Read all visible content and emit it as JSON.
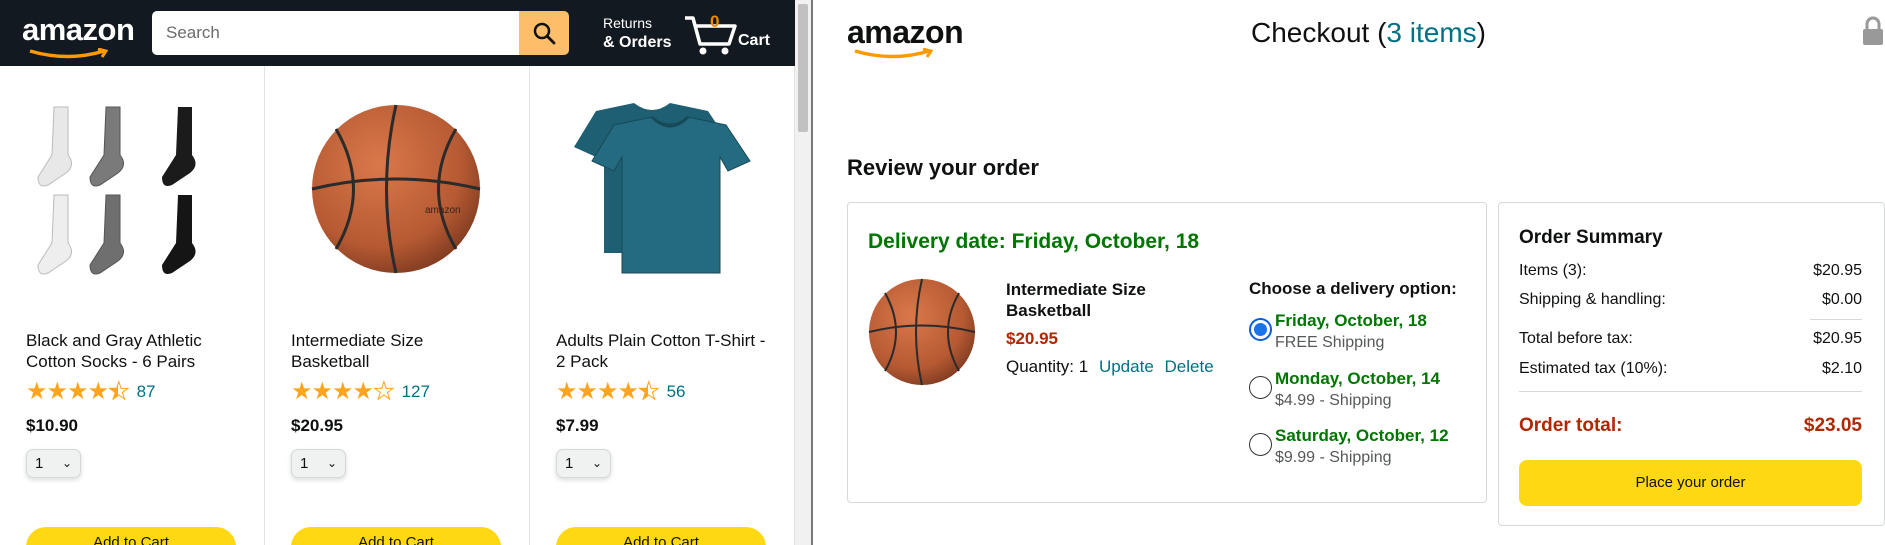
{
  "store": {
    "logo": "amazon",
    "search": {
      "placeholder": "Search"
    },
    "returns": {
      "line1": "Returns",
      "line2": "& Orders"
    },
    "cart": {
      "count": "0",
      "label": "Cart"
    },
    "products": [
      {
        "name": "Black and Gray Athletic Cotton Socks - 6 Pairs",
        "stars": 4.5,
        "rating_count": "87",
        "price": "$10.90",
        "qty": "1",
        "add_label": "Add to Cart",
        "image": "socks"
      },
      {
        "name": "Intermediate Size Basketball",
        "stars": 4.0,
        "rating_count": "127",
        "price": "$20.95",
        "qty": "1",
        "add_label": "Add to Cart",
        "image": "basketball"
      },
      {
        "name": "Adults Plain Cotton T-Shirt - 2 Pack",
        "stars": 4.5,
        "rating_count": "56",
        "price": "$7.99",
        "qty": "1",
        "add_label": "Add to Cart",
        "image": "tshirts"
      }
    ]
  },
  "checkout": {
    "logo": "amazon",
    "title_prefix": "Checkout (",
    "title_items": "3 items",
    "title_suffix": ")",
    "review_title": "Review your order",
    "order": {
      "delivery_date": "Delivery date: Friday, October, 18",
      "item_name": "Intermediate Size Basketball",
      "item_price": "$20.95",
      "quantity_label": "Quantity: 1",
      "update_label": "Update",
      "delete_label": "Delete",
      "choose_label": "Choose a delivery option:",
      "options": [
        {
          "date": "Friday, October, 18",
          "shipping": "FREE Shipping",
          "selected": true
        },
        {
          "date": "Monday, October, 14",
          "shipping": "$4.99 - Shipping",
          "selected": false
        },
        {
          "date": "Saturday, October, 12",
          "shipping": "$9.99 - Shipping",
          "selected": false
        }
      ]
    },
    "summary": {
      "title": "Order Summary",
      "items_label": "Items (3):",
      "items_value": "$20.95",
      "shipping_label": "Shipping & handling:",
      "shipping_value": "$0.00",
      "before_tax_label": "Total before tax:",
      "before_tax_value": "$20.95",
      "tax_label": "Estimated tax (10%):",
      "tax_value": "$2.10",
      "total_label": "Order total:",
      "total_value": "$23.05",
      "place_order_label": "Place your order"
    }
  },
  "colors": {
    "nav_bg": "#131921",
    "search_button": "#febd69",
    "accent_yellow": "#ffd814",
    "star": "#ffa41c",
    "link": "#017185",
    "green": "#007600",
    "price_red": "#b12704"
  }
}
